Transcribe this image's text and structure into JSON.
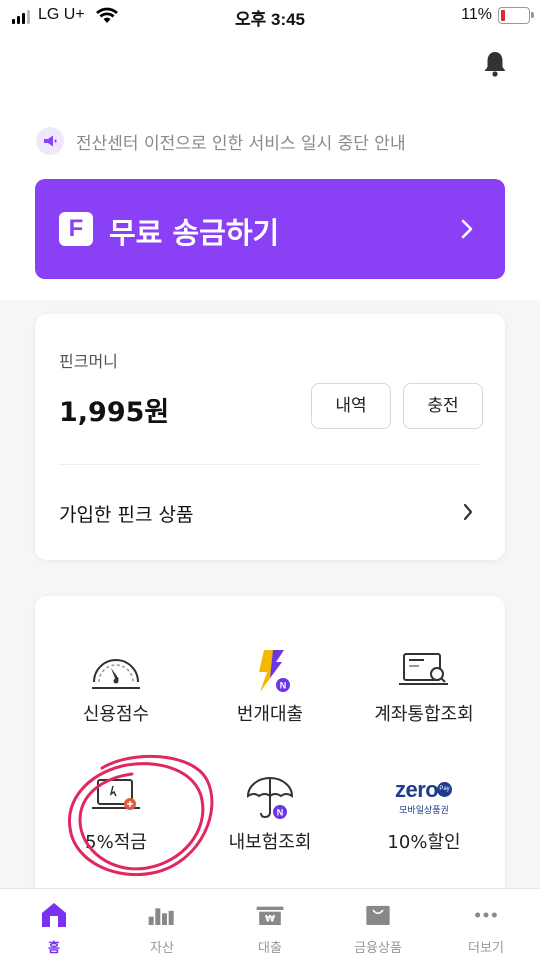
{
  "status_bar": {
    "carrier": "LG U+",
    "time": "오후 3:45",
    "battery": "11%"
  },
  "header": {
    "bell_icon": "bell-icon"
  },
  "notice": {
    "icon": "megaphone-icon",
    "text": "전산센터 이전으로 인한 서비스 일시 중단 안내"
  },
  "transfer": {
    "logo": "F",
    "label": "무료 송금하기",
    "accent": "#8a40f5"
  },
  "money": {
    "label": "핀크머니",
    "amount": "1,995원",
    "history_label": "내역",
    "charge_label": "충전",
    "products_label": "가입한 핀크 상품"
  },
  "services": [
    {
      "label": "신용점수",
      "icon": "speedometer-icon"
    },
    {
      "label": "번개대출",
      "icon": "lightning-icon",
      "badge": "N"
    },
    {
      "label": "계좌통합조회",
      "icon": "account-search-icon"
    },
    {
      "label": "5%적금",
      "icon": "savings-laptop-icon"
    },
    {
      "label": "내보험조회",
      "icon": "umbrella-icon",
      "badge": "N"
    },
    {
      "label": "10%할인",
      "icon": "zeropay-logo",
      "logo_text": "zero",
      "logo_pay": "Pay",
      "logo_sub": "모바일상품권"
    }
  ],
  "tabs": [
    {
      "label": "홈",
      "icon": "home-icon",
      "active": true
    },
    {
      "label": "자산",
      "icon": "bar-chart-icon",
      "active": false
    },
    {
      "label": "대출",
      "icon": "loan-icon",
      "active": false
    },
    {
      "label": "금융상품",
      "icon": "shopping-bag-icon",
      "active": false
    },
    {
      "label": "더보기",
      "icon": "more-dots-icon",
      "active": false
    }
  ],
  "colors": {
    "brand": "#8a40f5",
    "annotation": "#e0285f"
  }
}
